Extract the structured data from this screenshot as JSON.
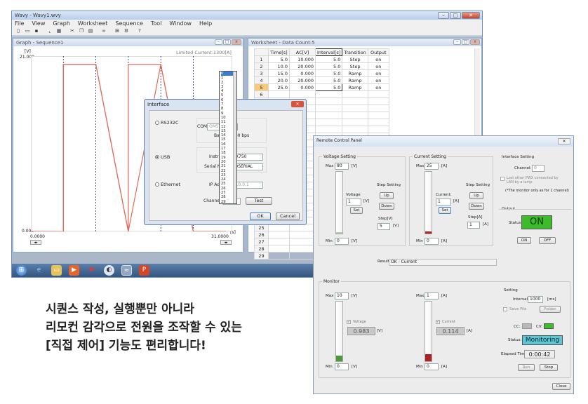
{
  "main_window": {
    "title": "Wavy - Wavy1.wvy",
    "menu": [
      "File",
      "View",
      "Graph",
      "Worksheet",
      "Sequence",
      "Tool",
      "Window",
      "Help"
    ],
    "toolbar_icons": [
      "new-icon",
      "open-icon",
      "save-icon",
      "graph-icon",
      "worksheet-icon",
      "cut-icon",
      "copy-icon",
      "paste-icon",
      "link-icon",
      "sequence-icon",
      "settings-icon",
      "help-icon"
    ]
  },
  "graph": {
    "title": "Graph - Sequence1",
    "y_unit": "[V]",
    "y_max": "21.000",
    "y_min": "0.000",
    "limited_current": "Limited Current:1300[A]",
    "x_min": "0.0000",
    "x_max": "31.0000",
    "x_unit": "[s]"
  },
  "chart_data": {
    "type": "line",
    "series": [
      {
        "x": [
          0,
          5,
          5,
          10,
          15,
          15,
          20,
          25,
          30
        ],
        "y": [
          0,
          0,
          20,
          20,
          0,
          20,
          20,
          0,
          0
        ]
      },
      {
        "x": [
          0,
          5,
          5,
          10,
          15,
          20,
          25,
          30
        ],
        "y": [
          0,
          0,
          20,
          20,
          0,
          20,
          0,
          0
        ]
      }
    ],
    "xlim": [
      0,
      31
    ],
    "ylim": [
      0,
      21
    ]
  },
  "worksheet": {
    "title": "Worksheet - Data Count:5",
    "columns": [
      "Time[s]",
      "AC[V]",
      "Interval[s]",
      "Transition",
      "Output"
    ],
    "rows": [
      {
        "n": "1",
        "time": "5.0",
        "ac": "10.000",
        "interval": "5.0",
        "transition": "Step",
        "output": "on"
      },
      {
        "n": "2",
        "time": "10.0",
        "ac": "20.000",
        "interval": "5.0",
        "transition": "Step",
        "output": "on"
      },
      {
        "n": "3",
        "time": "15.0",
        "ac": "0.000",
        "interval": "5.0",
        "transition": "Ramp",
        "output": "on"
      },
      {
        "n": "4",
        "time": "20.0",
        "ac": "20.000",
        "interval": "5.0",
        "transition": "Ramp",
        "output": "on"
      },
      {
        "n": "5",
        "time": "25.0",
        "ac": "0.000",
        "interval": "5.0",
        "transition": "Ramp",
        "output": "on"
      }
    ],
    "blank_rows": [
      "6",
      "7",
      "8",
      "9",
      "10",
      "11",
      "12",
      "13",
      "14",
      "15",
      "16",
      "17",
      "18",
      "19",
      "20",
      "21",
      "22",
      "23",
      "24",
      "25",
      "26",
      "27",
      "28",
      "29"
    ]
  },
  "interface_dialog": {
    "title": "Interface",
    "rs232c": "RS232C",
    "usb": "USB",
    "ethernet": "Ethernet",
    "com_label": "COM",
    "com_value": "OM5",
    "baud_label": "Ba",
    "baud_value": "200 bps",
    "inst_label": "Instr",
    "inst_value": "WX750",
    "serial_label": "Serial N",
    "serial_value": "NOSERIAL",
    "ip_label": "IP Ad",
    "ip_value": "27.0.0.1",
    "channel_label": "Channel:",
    "channel_value": "0",
    "test": "Test",
    "ok": "OK",
    "cancel": "Cancel",
    "channel_list": [
      "0",
      "1",
      "2",
      "3",
      "4",
      "5",
      "6",
      "7",
      "8",
      "9",
      "10",
      "11",
      "12",
      "13",
      "14",
      "15",
      "16",
      "17",
      "18",
      "19",
      "20",
      "21",
      "22",
      "23",
      "24",
      "25",
      "26",
      "27",
      "28",
      "29"
    ]
  },
  "remote": {
    "title": "Remote Control Panel",
    "voltage_setting": "Voltage Setting",
    "current_setting": "Current Setting",
    "interface_setting": "Interface Setting",
    "max": "Max",
    "min": "Min",
    "v_max": "80",
    "v_min": "0",
    "v_unit": "[V]",
    "a_max": "25",
    "a_min": "0",
    "a_unit": "[A]",
    "voltage_label": "Voltage",
    "voltage_value": "1",
    "current_label": "Current:",
    "current_value": "1",
    "set": "Set",
    "step_setting": "Step Setting",
    "up": "Up",
    "down": "Down",
    "step_v": "Step[V]",
    "step_v_value": "5",
    "step_a": "Step[A]",
    "step_a_value": "1",
    "channel_label": "Channel:",
    "channel_value": "0",
    "lost_other": "Lost other PWX connected by",
    "lost_other2": "LAN by a lamp",
    "monitor_note": "(*The monitor only as for 1 channel)",
    "output": "Output",
    "status_label": "Status",
    "status_value": "ON",
    "on": "ON",
    "off": "OFF",
    "result_label": "Result",
    "result_value": "OK - Current",
    "monitor": "Monitor",
    "mon_v_max": "10",
    "mon_v_min": "0",
    "mon_a_max": "1",
    "mon_a_min": "0",
    "mon_voltage": "Voltage",
    "mon_voltage_value": "0.983",
    "mon_current": "Current",
    "mon_current_value": "0.114",
    "setting": "Setting",
    "interval_label": "Interval",
    "interval_value": "1000",
    "interval_unit": "[ms]",
    "save_file": "Save File",
    "folder": "Folder",
    "cc": "CC:",
    "cv": "CV:",
    "mon_status_label": "Status:",
    "mon_status_value": "Monitoring",
    "elapsed_label": "Elapsed Time",
    "elapsed_value": "0:00:42",
    "run": "Run",
    "stop": "Stop",
    "close": "Close",
    "accent_green": "#3dbb2a",
    "accent_cyan": "#5bc7d6"
  },
  "caption": {
    "line1": "시퀀스 작성, 실행뿐만 아니라",
    "line2": "리모컨 감각으로 전원을 조작할 수 있는",
    "line3": "[직접 제어] 기능도 편리합니다!"
  }
}
